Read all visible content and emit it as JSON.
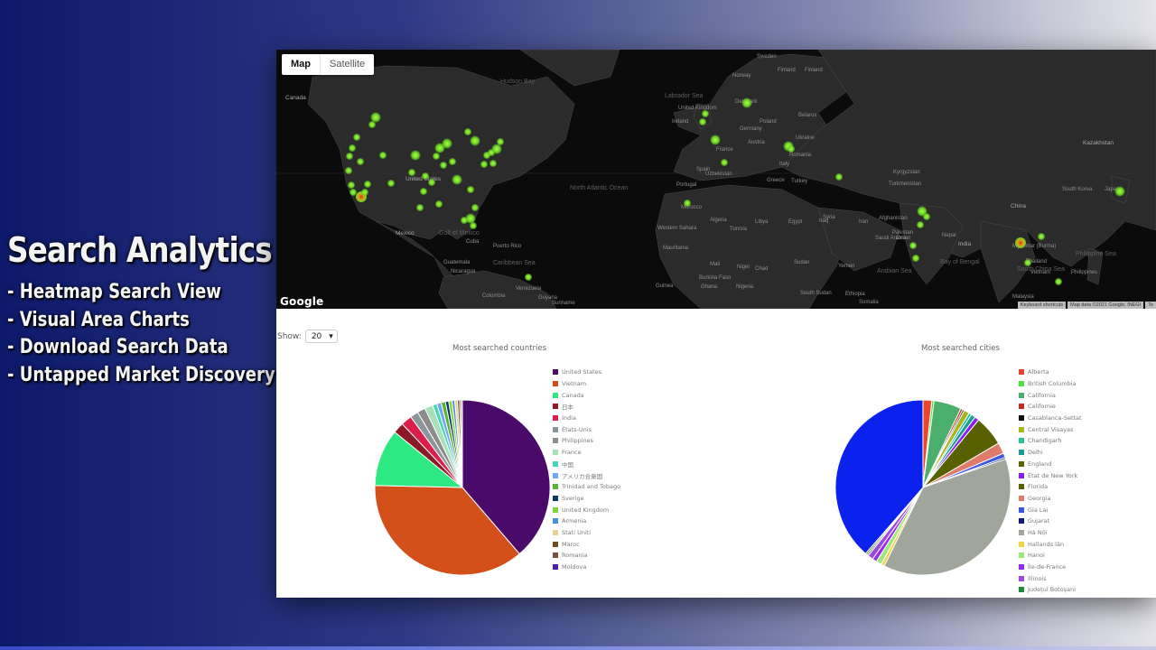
{
  "promo": {
    "title": "Search Analytics",
    "items": [
      "- Heatmap Search View",
      "- Visual Area Charts",
      "- Download Search Data",
      "- Untapped Market Discovery"
    ]
  },
  "map": {
    "type_control": [
      {
        "label": "Map",
        "active": true
      },
      {
        "label": "Satellite",
        "active": false
      }
    ],
    "logo": "Google",
    "attribution": [
      "Keyboard shortcuts",
      "Map data ©2021 Google, INEGI",
      "Te"
    ],
    "labels": [
      {
        "text": "Canada",
        "cls": "big"
      },
      {
        "text": "Hudson Bay",
        "cls": "ocean"
      },
      {
        "text": "Labrador Sea",
        "cls": "ocean"
      },
      {
        "text": "United States",
        "cls": "big"
      },
      {
        "text": "Mexico",
        "cls": "big"
      },
      {
        "text": "Gulf of Mexico",
        "cls": "ocean"
      },
      {
        "text": "Cuba",
        "cls": ""
      },
      {
        "text": "Puerto Rico",
        "cls": ""
      },
      {
        "text": "Guatemala",
        "cls": ""
      },
      {
        "text": "Caribbean Sea",
        "cls": "ocean"
      },
      {
        "text": "Nicaragua",
        "cls": ""
      },
      {
        "text": "Venezuela",
        "cls": ""
      },
      {
        "text": "Colombia",
        "cls": ""
      },
      {
        "text": "Guyana",
        "cls": ""
      },
      {
        "text": "Suriname",
        "cls": ""
      },
      {
        "text": "North Atlantic Ocean",
        "cls": "ocean"
      },
      {
        "text": "Sweden",
        "cls": ""
      },
      {
        "text": "Finland",
        "cls": ""
      },
      {
        "text": "Norway",
        "cls": ""
      },
      {
        "text": "Denmark",
        "cls": ""
      },
      {
        "text": "United Kingdom",
        "cls": ""
      },
      {
        "text": "Ireland",
        "cls": ""
      },
      {
        "text": "Belarus",
        "cls": ""
      },
      {
        "text": "Poland",
        "cls": ""
      },
      {
        "text": "Germany",
        "cls": ""
      },
      {
        "text": "Ukraine",
        "cls": ""
      },
      {
        "text": "Austria",
        "cls": ""
      },
      {
        "text": "France",
        "cls": ""
      },
      {
        "text": "Romania",
        "cls": ""
      },
      {
        "text": "Italy",
        "cls": ""
      },
      {
        "text": "Spain",
        "cls": ""
      },
      {
        "text": "Portugal",
        "cls": ""
      },
      {
        "text": "Greece",
        "cls": ""
      },
      {
        "text": "Turkey",
        "cls": ""
      },
      {
        "text": "Kazakhstan",
        "cls": "big"
      },
      {
        "text": "Uzbekistan",
        "cls": ""
      },
      {
        "text": "Kyrgyzstan",
        "cls": ""
      },
      {
        "text": "Turkmenistan",
        "cls": ""
      },
      {
        "text": "Finland",
        "cls": ""
      },
      {
        "text": "Morocco",
        "cls": ""
      },
      {
        "text": "Algeria",
        "cls": ""
      },
      {
        "text": "Libya",
        "cls": ""
      },
      {
        "text": "Egypt",
        "cls": ""
      },
      {
        "text": "Syria",
        "cls": ""
      },
      {
        "text": "Iraq",
        "cls": ""
      },
      {
        "text": "Iran",
        "cls": ""
      },
      {
        "text": "Afghanistan",
        "cls": ""
      },
      {
        "text": "Pakistan",
        "cls": ""
      },
      {
        "text": "China",
        "cls": "big"
      },
      {
        "text": "South Korea",
        "cls": ""
      },
      {
        "text": "Japan",
        "cls": ""
      },
      {
        "text": "Nepal",
        "cls": ""
      },
      {
        "text": "India",
        "cls": "big"
      },
      {
        "text": "Saudi Arabia",
        "cls": ""
      },
      {
        "text": "Oman",
        "cls": ""
      },
      {
        "text": "Mauritania",
        "cls": ""
      },
      {
        "text": "Mali",
        "cls": ""
      },
      {
        "text": "Niger",
        "cls": ""
      },
      {
        "text": "Chad",
        "cls": ""
      },
      {
        "text": "Sudan",
        "cls": ""
      },
      {
        "text": "Yemen",
        "cls": ""
      },
      {
        "text": "Nigeria",
        "cls": ""
      },
      {
        "text": "South Sudan",
        "cls": ""
      },
      {
        "text": "Ethiopia",
        "cls": ""
      },
      {
        "text": "Somalia",
        "cls": ""
      },
      {
        "text": "Arabian Sea",
        "cls": "ocean"
      },
      {
        "text": "Bay of Bengal",
        "cls": "ocean"
      },
      {
        "text": "Myanmar (Burma)",
        "cls": ""
      },
      {
        "text": "Thailand",
        "cls": ""
      },
      {
        "text": "Vietnam",
        "cls": ""
      },
      {
        "text": "Philippines",
        "cls": ""
      },
      {
        "text": "Philippine Sea",
        "cls": "ocean"
      },
      {
        "text": "South China Sea",
        "cls": "ocean"
      },
      {
        "text": "Malaysia",
        "cls": ""
      },
      {
        "text": "Western Sahara",
        "cls": ""
      },
      {
        "text": "Guinea",
        "cls": ""
      },
      {
        "text": "Burkina Faso",
        "cls": ""
      },
      {
        "text": "Ghana",
        "cls": ""
      },
      {
        "text": "Tunisia",
        "cls": ""
      }
    ]
  },
  "controls": {
    "show_label": "Show:",
    "show_value": "20",
    "chevron": "▾"
  },
  "chart_data": [
    {
      "type": "pie",
      "title": "Most searched countries",
      "legend_position": "right",
      "categories": [
        "United States",
        "Vietnam",
        "Canada",
        "日本",
        "India",
        "États-Unis",
        "Philippines",
        "France",
        "中国",
        "アメリカ合衆国",
        "Trinidad and Tobago",
        "Sverige",
        "United Kingdom",
        "Armenia",
        "Stati Uniti",
        "Maroc",
        "Romania",
        "Moldova"
      ],
      "values": [
        38.5,
        36.5,
        10.5,
        2.0,
        2.0,
        1.5,
        1.5,
        1.5,
        0.8,
        0.8,
        0.8,
        0.6,
        0.6,
        0.5,
        0.5,
        0.4,
        0.3,
        0.2
      ],
      "colors": [
        "#4a0a6a",
        "#d3501b",
        "#2ee882",
        "#8b1a24",
        "#dc1e4c",
        "#8a9699",
        "#8c8c8c",
        "#a8e0b8",
        "#49d6b8",
        "#72a8ef",
        "#5cb335",
        "#0c3a60",
        "#7dd63a",
        "#4892d4",
        "#e8d29a",
        "#6f4c23",
        "#7a5040",
        "#4b1fa0"
      ]
    },
    {
      "type": "pie",
      "title": "Most searched cities",
      "legend_position": "right",
      "categories": [
        "Alberta",
        "British Columbia",
        "California",
        "Californie",
        "Casablanca-Settat",
        "Central Visayas",
        "Chandigarh",
        "Delhi",
        "England",
        "État de New York",
        "Florida",
        "Georgia",
        "Gia Lai",
        "Gujarat",
        "Hà Nội",
        "Hallands län",
        "Hanoi",
        "Île-de-France",
        "Illinois",
        "Județul Botoșani"
      ],
      "values": [
        1.6,
        0.4,
        5.0,
        0.4,
        0.3,
        1.0,
        0.5,
        0.8,
        0.3,
        0.8,
        5.5,
        2.0,
        0.8,
        0.3,
        37.0,
        0.6,
        1.0,
        0.8,
        1.0,
        0.3
      ],
      "order_clockwise_from_top": [
        "Alberta",
        "Hanoi",
        "California",
        "Californie",
        "Casablanca-Settat",
        "Georgia",
        "Central Visayas",
        "Chandigarh",
        "Delhi",
        "État de New York",
        "Illinois",
        "Florida",
        "Georgia",
        "Gia Lai",
        "Hà Nội",
        "Hallands län",
        "Hanoi",
        "Île-de-France",
        "Illinois",
        "British Columbia"
      ],
      "colors": [
        "#e8462e",
        "#4ee43a",
        "#4aaf6c",
        "#c42c1d",
        "#111111",
        "#a9b51a",
        "#27c19a",
        "#1a9c9a",
        "#5b6400",
        "#8a1ef0",
        "#596000",
        "#e07b6b",
        "#3958e0",
        "#0e1d7a",
        "#a0a69c",
        "#f2d24a",
        "#9ee87a",
        "#9a2cf0",
        "#9a4ae0",
        "#1e8a3a"
      ],
      "big_slice": {
        "label": "(unlabeled, blue)",
        "value": 38.0,
        "color": "#0b22ee"
      }
    }
  ]
}
